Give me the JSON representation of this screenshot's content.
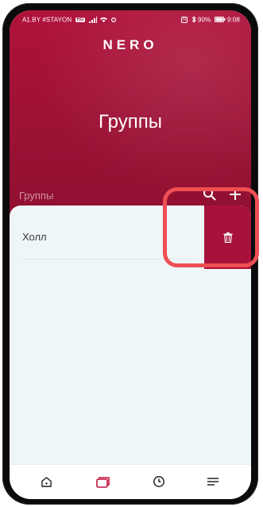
{
  "status_bar": {
    "left": "A1.BY #STAYON",
    "left_badge": "HD",
    "right_nfc": "N",
    "right_battery": "90%",
    "right_time": "9:08"
  },
  "header": {
    "logo": "NERO",
    "title": "Группы",
    "section_label": "Группы",
    "search_icon": "search-icon",
    "add_icon": "plus-icon"
  },
  "groups": [
    {
      "name": "Холл"
    }
  ],
  "delete_action": {
    "icon": "trash-icon"
  },
  "nav": {
    "items": [
      {
        "icon": "home-icon",
        "active": false
      },
      {
        "icon": "groups-icon",
        "active": true
      },
      {
        "icon": "clock-icon",
        "active": false
      },
      {
        "icon": "menu-icon",
        "active": false
      }
    ]
  },
  "colors": {
    "brand": "#a8123a",
    "highlight": "#ef4f53",
    "sheet_bg": "#eef6f8"
  }
}
